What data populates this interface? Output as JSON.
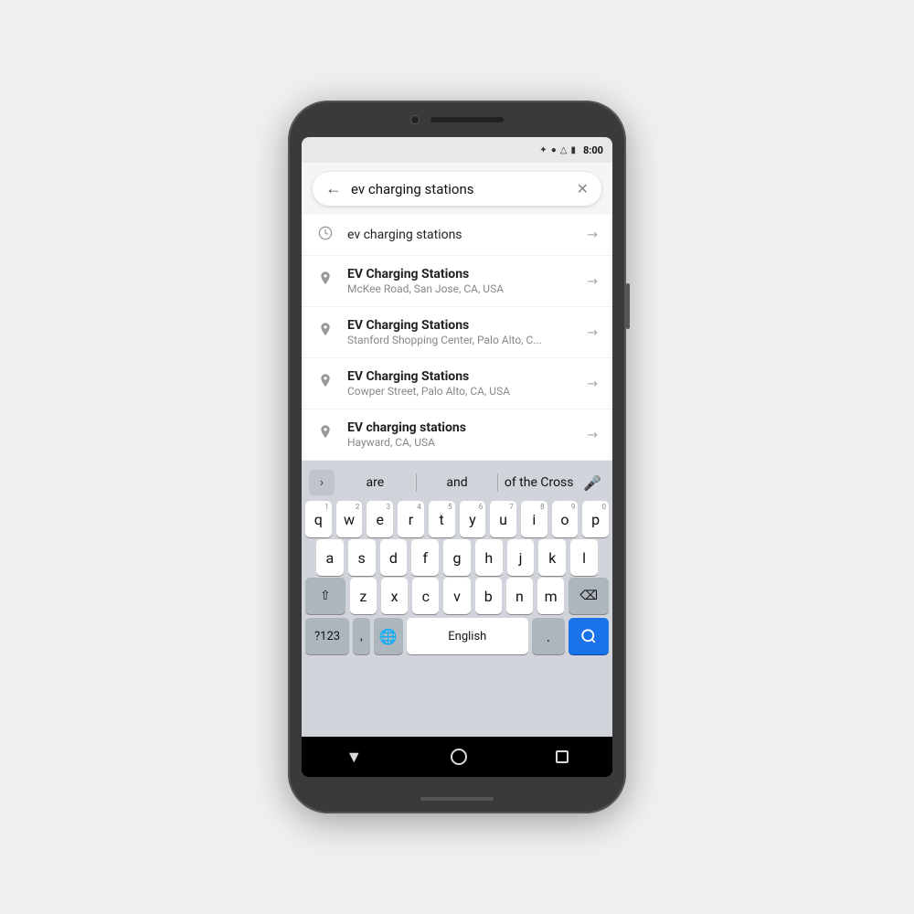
{
  "phone": {
    "status_bar": {
      "time": "8:00",
      "icons": [
        "bluetooth",
        "wifi",
        "signal",
        "battery"
      ]
    },
    "search": {
      "query": "ev charging stations",
      "back_icon": "←",
      "clear_icon": "✕"
    },
    "suggestions": [
      {
        "type": "history",
        "icon": "🕐",
        "title": "ev charging stations",
        "subtitle": "",
        "is_bold": false
      },
      {
        "type": "place",
        "icon": "📍",
        "title": "EV Charging Stations",
        "subtitle": "McKee Road, San Jose, CA, USA",
        "is_bold": true
      },
      {
        "type": "place",
        "icon": "📍",
        "title": "EV Charging Stations",
        "subtitle": "Stanford Shopping Center, Palo Alto, C...",
        "is_bold": true
      },
      {
        "type": "place",
        "icon": "📍",
        "title": "EV Charging Stations",
        "subtitle": "Cowper Street, Palo Alto, CA, USA",
        "is_bold": true
      },
      {
        "type": "place",
        "icon": "📍",
        "title": "EV charging stations",
        "subtitle": "Hayward, CA, USA",
        "is_bold": true
      }
    ],
    "word_suggestions": [
      "are",
      "and",
      "of the Cross"
    ],
    "keyboard": {
      "row1": [
        "q",
        "w",
        "e",
        "r",
        "t",
        "y",
        "u",
        "i",
        "o",
        "p"
      ],
      "row1_nums": [
        "1",
        "2",
        "3",
        "4",
        "5",
        "6",
        "7",
        "8",
        "9",
        "0"
      ],
      "row2": [
        "a",
        "s",
        "d",
        "f",
        "g",
        "h",
        "j",
        "k",
        "l"
      ],
      "row3": [
        "z",
        "x",
        "c",
        "v",
        "b",
        "n",
        "m"
      ],
      "bottom": {
        "special_label": "?123",
        "comma": ",",
        "globe_icon": "🌐",
        "space_label": "English",
        "period": ".",
        "search_icon": "🔍"
      }
    },
    "nav_bar": {
      "back_icon": "▼",
      "home_icon": "○",
      "recent_icon": "□"
    }
  }
}
